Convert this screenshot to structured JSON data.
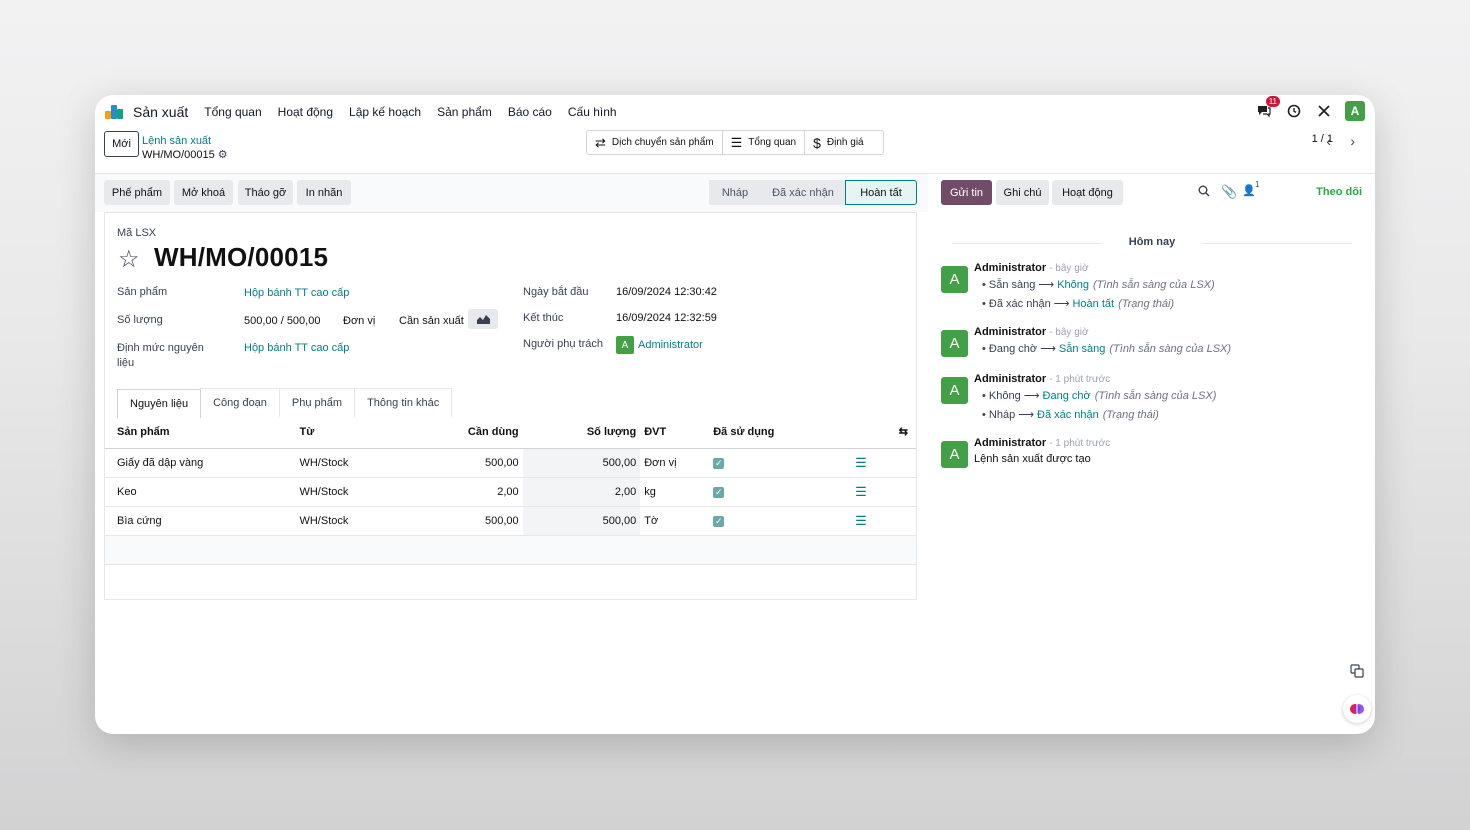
{
  "nav": {
    "app_name": "Sản xuất",
    "menus": [
      "Tổng quan",
      "Hoạt động",
      "Lập kế hoạch",
      "Sản phẩm",
      "Báo cáo",
      "Cấu hình"
    ],
    "chat_badge": "11",
    "user_initial": "A"
  },
  "control": {
    "new_button": "Mới",
    "breadcrumb_parent": "Lệnh sản xuất",
    "breadcrumb_current": "WH/MO/00015",
    "smart_buttons": [
      "Dịch chuyển sản phẩm",
      "Tổng quan",
      "Định giá"
    ],
    "pager": "1 / 1"
  },
  "actions": {
    "buttons": [
      "Phế phẩm",
      "Mở khoá",
      "Tháo gỡ",
      "In nhãn"
    ],
    "stages": [
      "Nháp",
      "Đã xác nhận",
      "Hoàn tất"
    ],
    "current_stage": "Hoàn tất"
  },
  "form": {
    "ref_label": "Mã LSX",
    "title": "WH/MO/00015",
    "product_label": "Sản phẩm",
    "product_value": "Hộp bánh TT cao cấp",
    "qty_label": "Số lượng",
    "qty_value": "500,00 / 500,00",
    "qty_uom": "Đơn vị",
    "to_produce_label": "Cần sản xuất",
    "bom_label": "Định mức nguyên liệu",
    "bom_value": "Hộp bánh TT cao cấp",
    "start_label": "Ngày bắt đầu",
    "start_value": "16/09/2024 12:30:42",
    "end_label": "Kết thúc",
    "end_value": "16/09/2024 12:32:59",
    "responsible_label": "Người phụ trách",
    "responsible_value": "Administrator",
    "tabs": [
      "Nguyên liệu",
      "Công đoạn",
      "Phụ phẩm",
      "Thông tin khác"
    ],
    "columns": [
      "Sản phẩm",
      "Từ",
      "Cần dùng",
      "Số lượng",
      "ĐVT",
      "Đã sử dụng"
    ],
    "rows": [
      {
        "product": "Giấy đã dập vàng",
        "from": "WH/Stock",
        "needed": "500,00",
        "qty": "500,00",
        "uom": "Đơn vị"
      },
      {
        "product": "Keo",
        "from": "WH/Stock",
        "needed": "2,00",
        "qty": "2,00",
        "uom": "kg"
      },
      {
        "product": "Bìa cứng",
        "from": "WH/Stock",
        "needed": "500,00",
        "qty": "500,00",
        "uom": "Tờ"
      }
    ]
  },
  "chatter": {
    "send_message": "Gửi tin",
    "log_note": "Ghi chú",
    "activities": "Hoạt động",
    "follower_count": "1",
    "follow": "Theo dõi",
    "today": "Hôm nay",
    "messages": [
      {
        "author": "Administrator",
        "time": "- bây giờ",
        "changes": [
          {
            "old": "Sẵn sàng",
            "new": "Không",
            "field": "(Tình sẵn sàng của LSX)"
          },
          {
            "old": "Đã xác nhận",
            "new": "Hoàn tất",
            "field": "(Trạng thái)"
          }
        ]
      },
      {
        "author": "Administrator",
        "time": "- bây giờ",
        "changes": [
          {
            "old": "Đang chờ",
            "new": "Sẵn sàng",
            "field": "(Tình sẵn sàng của LSX)"
          }
        ]
      },
      {
        "author": "Administrator",
        "time": "- 1 phút trước",
        "changes": [
          {
            "old": "Không",
            "new": "Đang chờ",
            "field": "(Tình sẵn sàng của LSX)"
          },
          {
            "old": "Nháp",
            "new": "Đã xác nhận",
            "field": "(Trạng thái)"
          }
        ]
      },
      {
        "author": "Administrator",
        "time": "- 1 phút trước",
        "body": "Lệnh sản xuất được tạo"
      }
    ]
  }
}
